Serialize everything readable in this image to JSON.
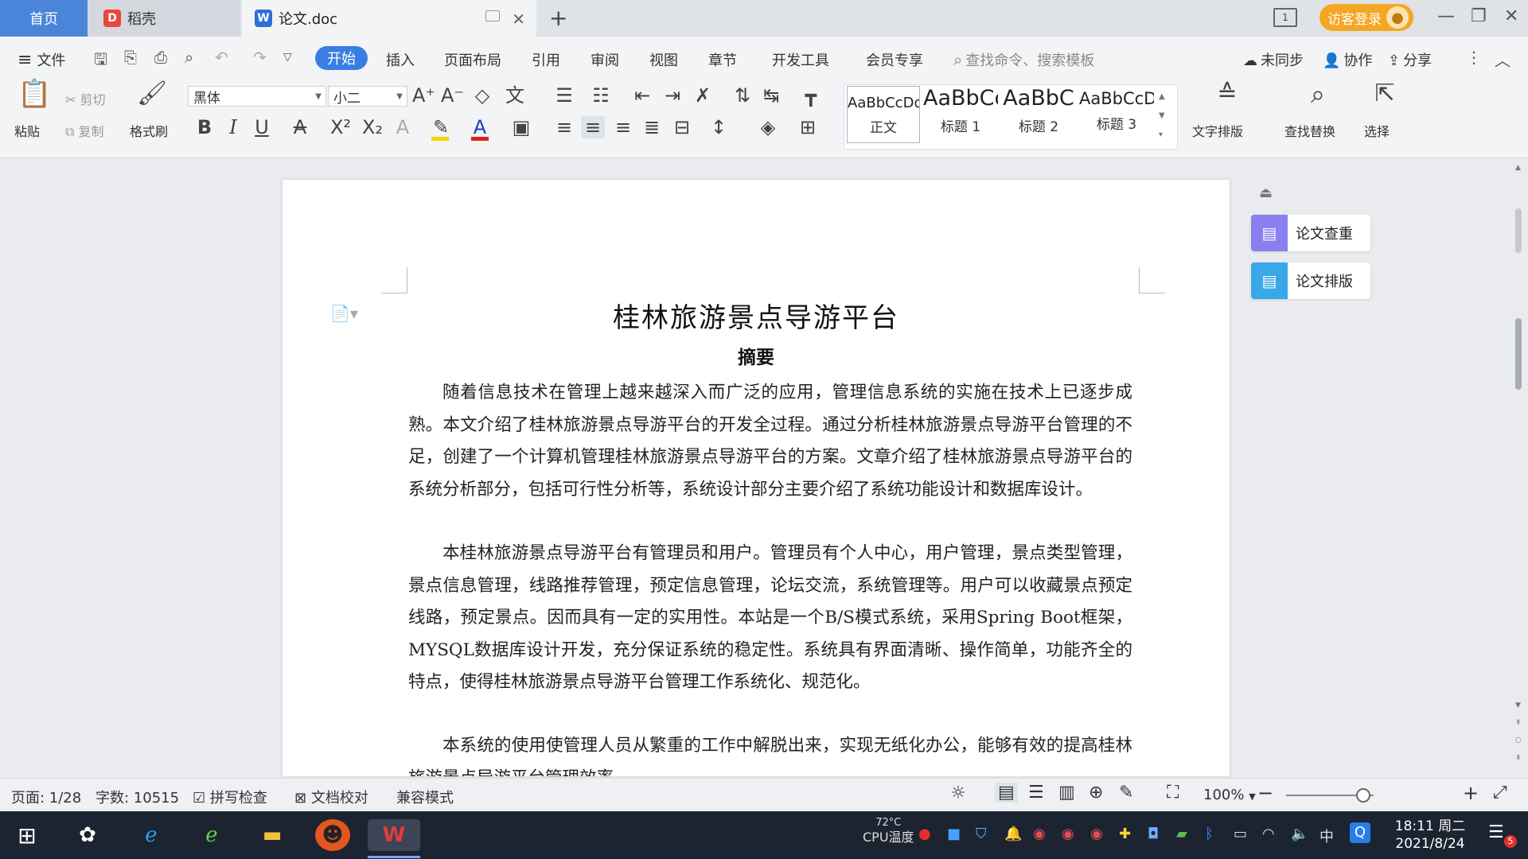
{
  "titlebar": {
    "tabs": [
      {
        "label": "首页",
        "icon": "home-tab"
      },
      {
        "label": "稻壳",
        "icon": "daoke-logo-icon"
      },
      {
        "label": "论文.doc",
        "icon": "word-doc-icon"
      }
    ],
    "new_tab": "+",
    "guest_login": "访客登录",
    "colors": {
      "accent": "#3a7ee4",
      "home_tab": "#4a85d9",
      "guest": "#f4a724"
    }
  },
  "menubar": {
    "file": "文件",
    "tabs": [
      "开始",
      "插入",
      "页面布局",
      "引用",
      "审阅",
      "视图",
      "章节",
      "开发工具",
      "会员专享"
    ],
    "active_tab": "开始",
    "search_placeholder": "查找命令、搜索模板",
    "sync": "未同步",
    "collab": "协作",
    "share": "分享"
  },
  "ribbon": {
    "paste": "粘贴",
    "cut": "剪切",
    "copy": "复制",
    "format_painter": "格式刷",
    "font_name": "黑体",
    "font_size": "小二",
    "styles": [
      {
        "sample": "AaBbCcDd",
        "name": "正文"
      },
      {
        "sample": "AaBbCc",
        "name": "标题 1"
      },
      {
        "sample": "AaBbC",
        "name": "标题 2"
      },
      {
        "sample": "AaBbCcDd",
        "name": "标题 3"
      }
    ],
    "text_layout": "文字排版",
    "find_replace": "查找替换",
    "select": "选择"
  },
  "document": {
    "title": "桂林旅游景点导游平台",
    "abstract_heading": "摘要",
    "paragraphs": [
      "随着信息技术在管理上越来越深入而广泛的应用，管理信息系统的实施在技术上已逐步成熟。本文介绍了桂林旅游景点导游平台的开发全过程。通过分析桂林旅游景点导游平台管理的不足，创建了一个计算机管理桂林旅游景点导游平台的方案。文章介绍了桂林旅游景点导游平台的系统分析部分，包括可行性分析等，系统设计部分主要介绍了系统功能设计和数据库设计。",
      "本桂林旅游景点导游平台有管理员和用户。管理员有个人中心，用户管理，景点类型管理，景点信息管理，线路推荐管理，预定信息管理，论坛交流，系统管理等。用户可以收藏景点预定线路，预定景点。因而具有一定的实用性。本站是一个B/S模式系统，采用Spring Boot框架，MYSQL数据库设计开发，充分保证系统的稳定性。系统具有界面清晰、操作简单，功能齐全的特点，使得桂林旅游景点导游平台管理工作系统化、规范化。",
      "本系统的使用使管理人员从繁重的工作中解脱出来，实现无纸化办公，能够有效的提高桂林旅游景点导游平台管理效率。"
    ]
  },
  "side_panel": {
    "items": [
      "论文查重",
      "论文排版"
    ]
  },
  "statusbar": {
    "page": "页面: 1/28",
    "word_count": "字数: 10515",
    "spell_check": "拼写检查",
    "doc_proof": "文档校对",
    "compat_mode": "兼容模式",
    "zoom": "100%",
    "zoom_fraction": 0.88
  },
  "taskbar": {
    "cpu_temp": "72°C",
    "cpu_label": "CPU温度",
    "ime": "中",
    "time": "18:11 周二",
    "date": "2021/8/24",
    "notif_count": "5"
  }
}
